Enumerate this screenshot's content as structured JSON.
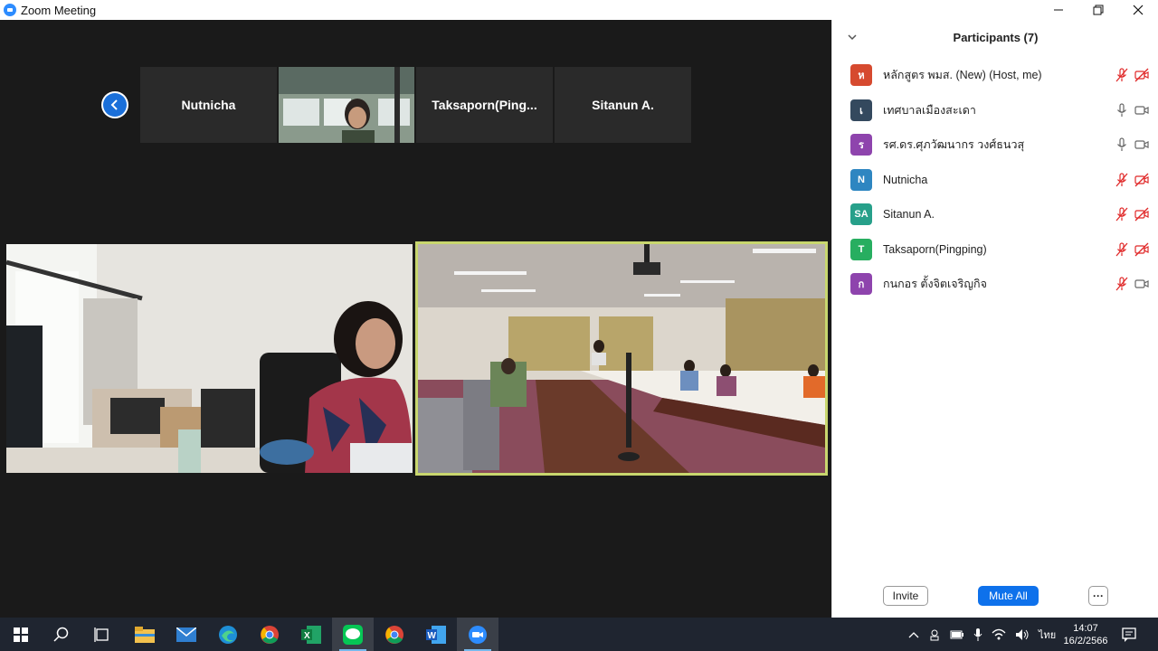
{
  "window": {
    "title": "Zoom Meeting",
    "minimize_icon": "minimize-icon",
    "restore_icon": "restore-icon",
    "close_icon": "close-icon"
  },
  "strip": {
    "prev_icon": "chevron-left-icon",
    "tiles": [
      {
        "label": "Nutnicha"
      },
      {
        "label": ""
      },
      {
        "label": "Taksaporn(Ping..."
      },
      {
        "label": "Sitanun A."
      }
    ]
  },
  "active_speaker_color": "#c8d66e",
  "participants": {
    "header": "Participants (7)",
    "items": [
      {
        "initial": "ห",
        "color": "#d64a2f",
        "name": "หลักสูตร พมส. (New) (Host, me)",
        "mic": "muted",
        "video": "off"
      },
      {
        "initial": "เ",
        "color": "#34495e",
        "name": "เทศบาลเมืองสะเดา",
        "mic": "on",
        "video": "on"
      },
      {
        "initial": "ร",
        "color": "#8e44ad",
        "name": "รศ.ดร.ศุภวัฒนากร วงศ์ธนวสุ",
        "mic": "on",
        "video": "on"
      },
      {
        "initial": "N",
        "color": "#2e86c1",
        "name": "Nutnicha",
        "mic": "muted",
        "video": "off"
      },
      {
        "initial": "SA",
        "color": "#27a08a",
        "name": "Sitanun A.",
        "mic": "muted",
        "video": "off"
      },
      {
        "initial": "T",
        "color": "#27ae60",
        "name": "Taksaporn(Pingping)",
        "mic": "muted",
        "video": "off"
      },
      {
        "initial": "ก",
        "color": "#8e44ad",
        "name": "กนกอร ตั้งจิตเจริญกิจ",
        "mic": "muted",
        "video": "on"
      }
    ],
    "invite_label": "Invite",
    "mute_all_label": "Mute All",
    "more_label": "···"
  },
  "taskbar": {
    "icons": [
      "windows-start-icon",
      "search-icon",
      "task-view-icon",
      "file-explorer-icon",
      "mail-icon",
      "edge-icon",
      "chrome-icon",
      "excel-icon",
      "line-icon",
      "chrome-icon",
      "word-icon",
      "zoom-icon"
    ],
    "lang": "ไทย",
    "time": "14:07",
    "date": "16/2/2566"
  }
}
